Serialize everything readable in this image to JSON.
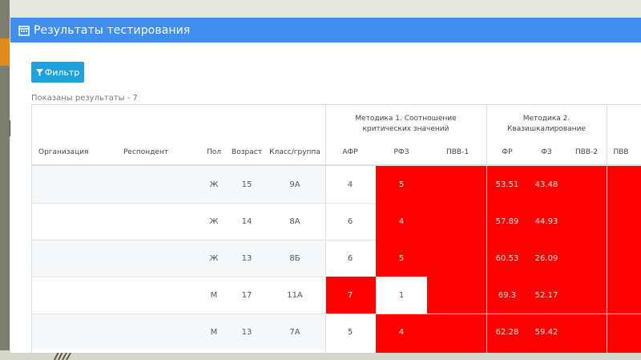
{
  "title": "Результаты тестирования",
  "filter_label": "Фильтр",
  "results_count": "Показаны результаты - 7",
  "group_headers": {
    "method1": "Методика 1. Соотношение критических значений",
    "method2": "Методика 2. Квазишкалирование"
  },
  "columns": {
    "org": "Организация",
    "respondent": "Респондент",
    "sex": "Пол",
    "age": "Возраст",
    "class": "Класс/группа",
    "afr": "АФР",
    "rfz": "РФЗ",
    "pvv1": "ПВВ-1",
    "fr": "ФР",
    "fz": "ФЗ",
    "pvv2": "ПВВ-2",
    "pvv": "ПВВ"
  },
  "rows": [
    {
      "sex": "Ж",
      "age": "15",
      "class": "9А",
      "afr": "4",
      "rfz": "5",
      "fr": "53.51",
      "fz": "43.48"
    },
    {
      "sex": "Ж",
      "age": "14",
      "class": "8А",
      "afr": "6",
      "rfz": "4",
      "fr": "57.89",
      "fz": "44.93"
    },
    {
      "sex": "Ж",
      "age": "13",
      "class": "8Б",
      "afr": "6",
      "rfz": "5",
      "fr": "60.53",
      "fz": "26.09"
    },
    {
      "sex": "М",
      "age": "17",
      "class": "11А",
      "afr": "7",
      "rfz": "1",
      "fr": "69.3",
      "fz": "52.17"
    },
    {
      "sex": "М",
      "age": "13",
      "class": "7А",
      "afr": "5",
      "rfz": "4",
      "fr": "62.28",
      "fz": "59.42"
    }
  ],
  "colors": {
    "header": "#3f8ef0",
    "button": "#1ea2de",
    "highlight": "#ff0000"
  }
}
